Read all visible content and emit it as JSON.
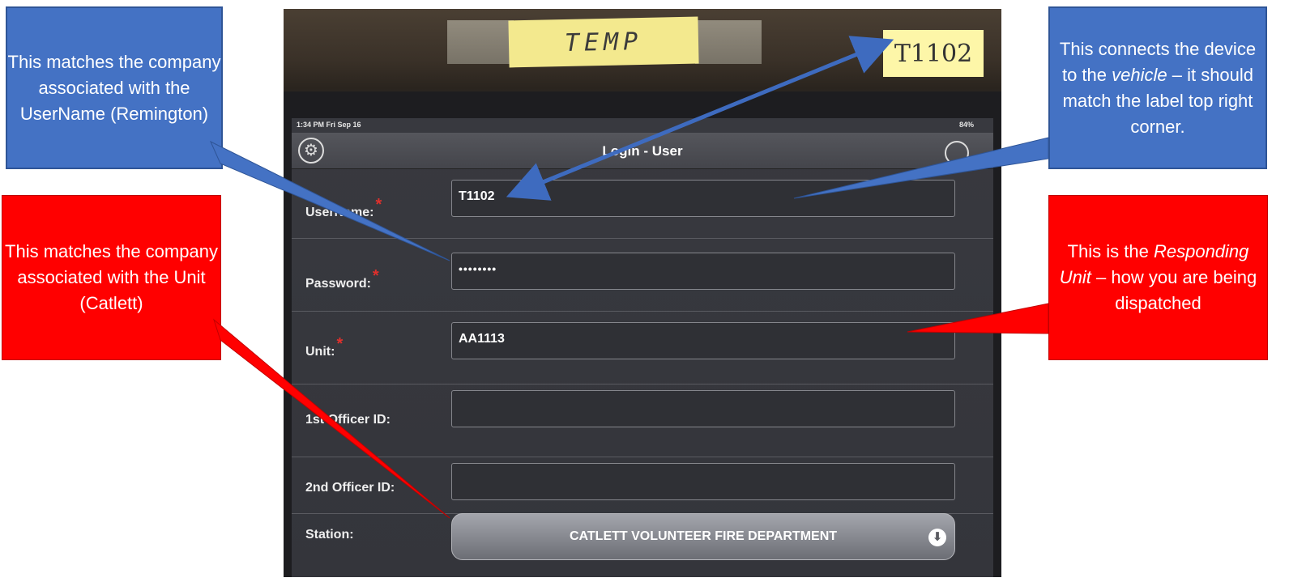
{
  "photo": {
    "temp_label": "TEMP",
    "device_tag": "T1102"
  },
  "tablet": {
    "status_time": "1:34 PM  Fri Sep 16",
    "status_battery": "84%",
    "nav_title": "Login - User",
    "fields": {
      "username": {
        "label": "UserName:",
        "value": "T1102",
        "required": "*"
      },
      "password": {
        "label": "Password:",
        "value": "••••••••",
        "required": "*"
      },
      "unit": {
        "label": "Unit:",
        "value": "AA1113",
        "required": "*"
      },
      "officer1": {
        "label": "1st Officer ID:",
        "value": ""
      },
      "officer2": {
        "label": "2nd Officer ID:",
        "value": ""
      },
      "station": {
        "label": "Station:",
        "value": "CATLETT VOLUNTEER FIRE DEPARTMENT"
      }
    }
  },
  "callouts": {
    "top_left": "This matches the company associated with the UserName (Remington)",
    "left": "This matches the company associated with the Unit (Catlett)",
    "top_right": {
      "before": "This connects the device to the",
      "emph": "vehicle",
      "after": "– it should match the label top right corner."
    },
    "right": {
      "before": "This is the",
      "emph": "Responding Unit",
      "after": "– how you are being dispatched"
    }
  },
  "colors": {
    "blue_callout": "#4472c4",
    "red_callout": "#ff0000",
    "required_star": "#e0302c"
  }
}
